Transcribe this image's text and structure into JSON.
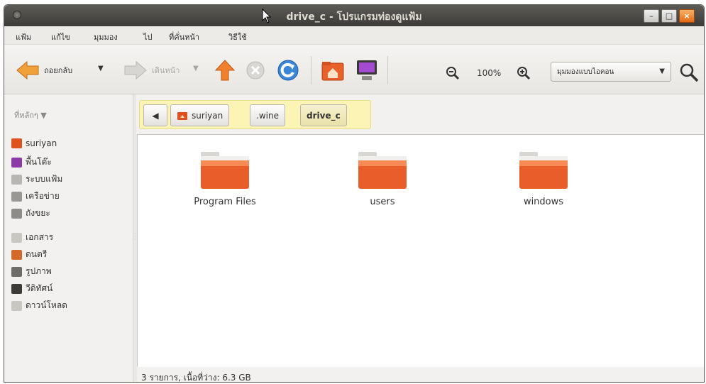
{
  "window": {
    "title": "drive_c - โปรแกรมท่องดูแฟ้ม",
    "min_label": "–",
    "max_label": "□",
    "close_label": "×"
  },
  "menu": [
    "แฟ้ม",
    "แก้ไข",
    "มุมมอง",
    "ไป",
    "ที่คั่นหน้า",
    "วิธีใช้"
  ],
  "toolbar": {
    "back_label": "ถอยกลับ",
    "forward_label": "เดินหน้า",
    "zoom_value": "100%",
    "view_mode": "มุมมองแบบไอคอน"
  },
  "sidebar": {
    "header": "ที่หลักๆ",
    "items": [
      {
        "label": "suriyan",
        "color": "#e0501e"
      },
      {
        "label": "พื้นโต๊ะ",
        "color": "#8c3aa8"
      },
      {
        "label": "ระบบแฟ้ม",
        "color": "#b8b6b2"
      },
      {
        "label": "เครือข่าย",
        "color": "#9a9894"
      },
      {
        "label": "ถังขยะ",
        "color": "#8e8c88"
      },
      {
        "label": "เอกสาร",
        "color": "#c9c7c2"
      },
      {
        "label": "ดนตรี",
        "color": "#d36a2a"
      },
      {
        "label": "รูปภาพ",
        "color": "#6e6c68"
      },
      {
        "label": "วีดิทัศน์",
        "color": "#3d3b37"
      },
      {
        "label": "ดาวน์โหลด",
        "color": "#c9c7c2"
      }
    ]
  },
  "pathbar": {
    "segments": [
      "suriyan",
      ".wine",
      "drive_c"
    ]
  },
  "folders": [
    "Program Files",
    "users",
    "windows"
  ],
  "status": "3 รายการ, เนื้อที่ว่าง: 6.3 GB",
  "colors": {
    "accent": "#f07746",
    "title_bg": "#3d3b37",
    "folder": "#e95d2a"
  }
}
